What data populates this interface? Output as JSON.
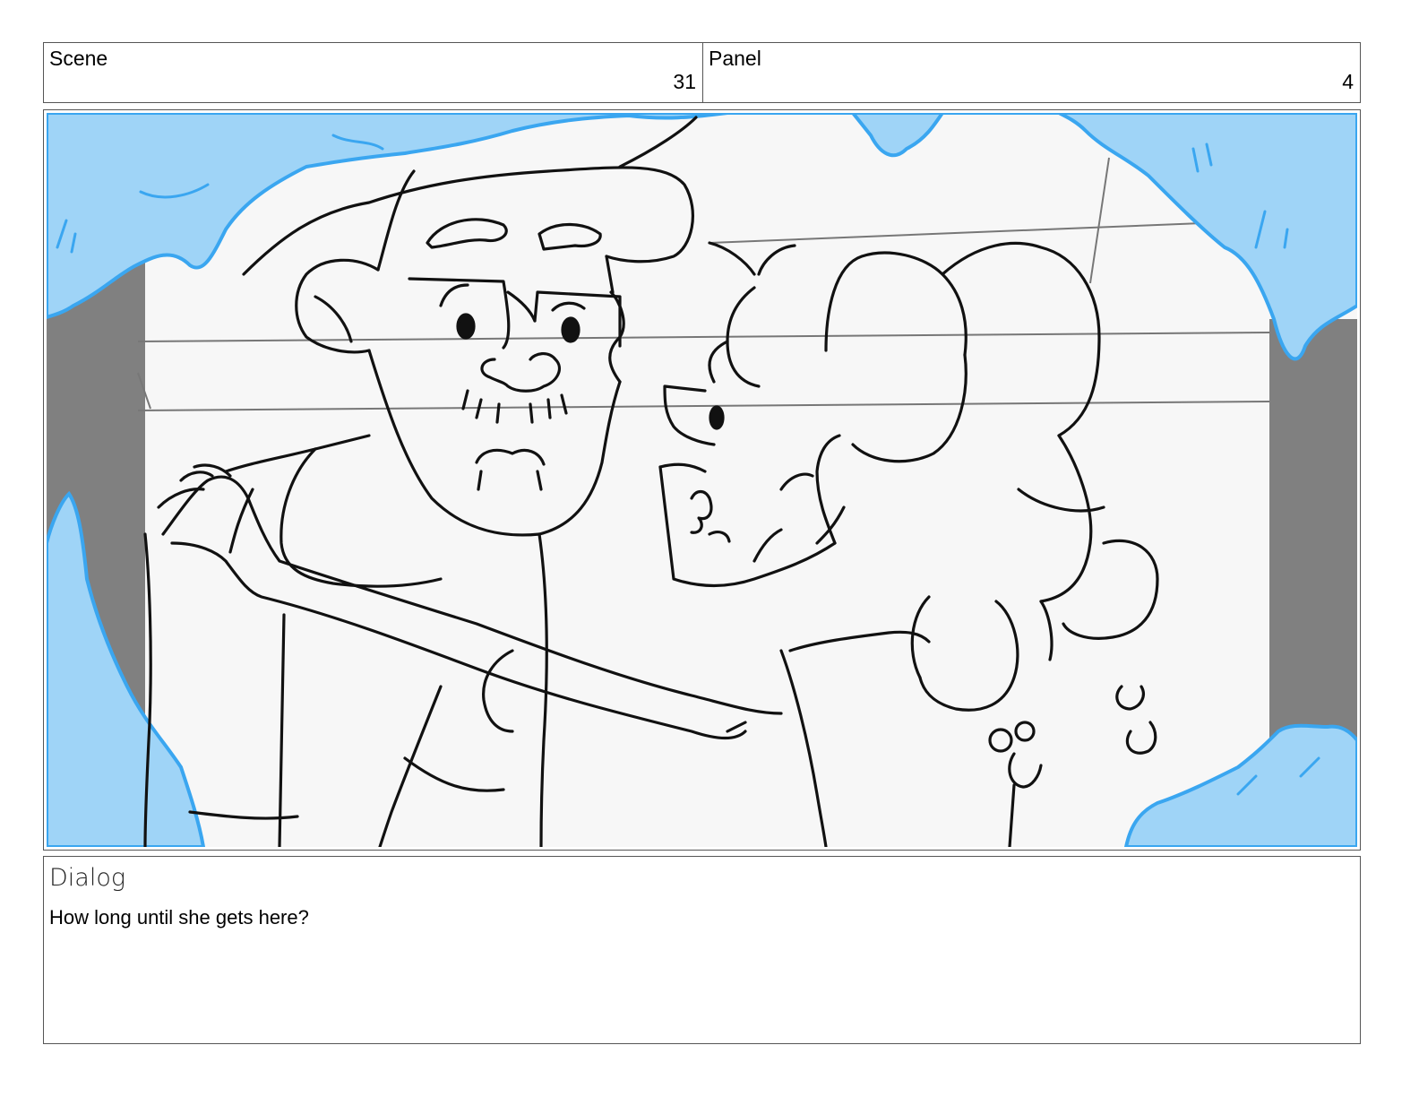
{
  "header": {
    "scene_label": "Scene",
    "scene_value": "31",
    "panel_label": "Panel",
    "panel_value": "4"
  },
  "artwork": {
    "description_icon": "storyboard-sketch-image",
    "colors": {
      "ice": "#9fd4f7",
      "ice_edge": "#3aa6f0",
      "wall": "#808080",
      "paper": "#f7f7f7",
      "line": "#111111"
    }
  },
  "dialog": {
    "label": "Dialog",
    "text": "How long until she gets here?"
  }
}
